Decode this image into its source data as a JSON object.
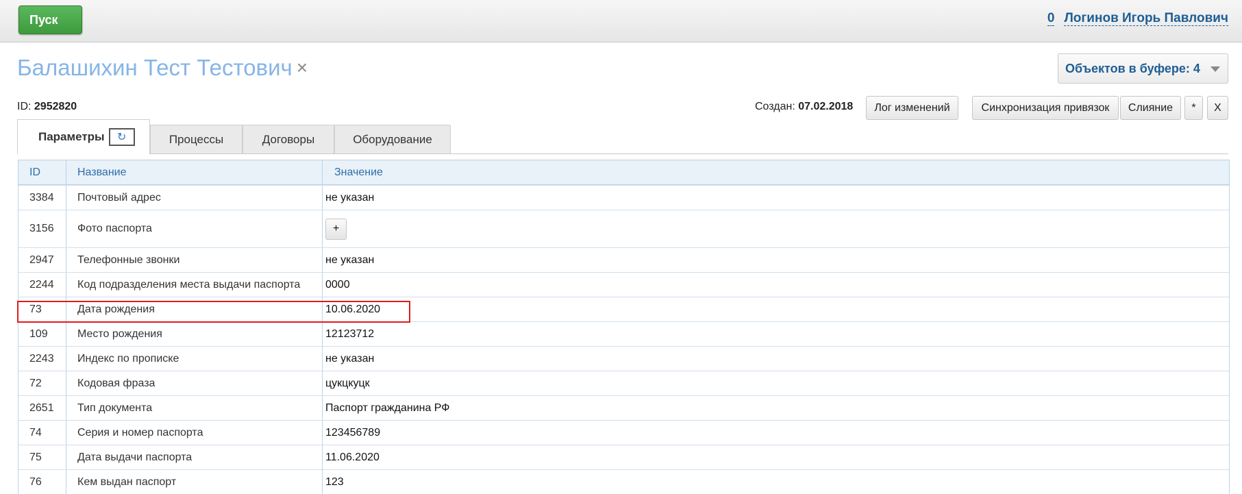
{
  "topbar": {
    "start_label": "Пуск",
    "counter": "0",
    "user_name": "Логинов Игорь Павлович"
  },
  "page": {
    "title": "Балашихин Тест Тестович",
    "close_glyph": "×",
    "buffer_label": "Объектов в буфере: 4",
    "id_label": "ID:",
    "id_value": "2952820",
    "created_label": "Создан:",
    "created_value": "07.02.2018"
  },
  "actions": {
    "log": "Лог изменений",
    "sync": "Синхронизация привязок",
    "merge": "Слияние",
    "star": "*",
    "close": "X"
  },
  "tabs": [
    {
      "label": "Параметры",
      "active": true
    },
    {
      "label": "Процессы"
    },
    {
      "label": "Договоры"
    },
    {
      "label": "Оборудование"
    }
  ],
  "table": {
    "headers": {
      "id": "ID",
      "name": "Название",
      "value": "Значение"
    },
    "rows": [
      {
        "id": "3384",
        "name": "Почтовый адрес",
        "value": "не указан"
      },
      {
        "id": "3156",
        "name": "Фото паспорта",
        "value": "+"
      },
      {
        "id": "2947",
        "name": "Телефонные звонки",
        "value": "не указан"
      },
      {
        "id": "2244",
        "name": "Код подразделения места выдачи паспорта",
        "value": "0000"
      },
      {
        "id": "73",
        "name": "Дата рождения",
        "value": "10.06.2020"
      },
      {
        "id": "109",
        "name": "Место рождения",
        "value": "12123712"
      },
      {
        "id": "2243",
        "name": "Индекс по прописке",
        "value": "не указан"
      },
      {
        "id": "72",
        "name": "Кодовая фраза",
        "value": "цукцкуцк"
      },
      {
        "id": "2651",
        "name": "Тип документа",
        "value": "Паспорт гражданина РФ"
      },
      {
        "id": "74",
        "name": "Серия и номер паспорта",
        "value": "123456789"
      },
      {
        "id": "75",
        "name": "Дата выдачи паспорта",
        "value": "11.06.2020"
      },
      {
        "id": "76",
        "name": "Кем выдан паспорт",
        "value": "123"
      }
    ]
  },
  "colors": {
    "accent_green": "#4cae4c",
    "link_blue": "#1d5e94",
    "title_blue": "#86b5e6",
    "highlight_red": "#e01b1b"
  }
}
